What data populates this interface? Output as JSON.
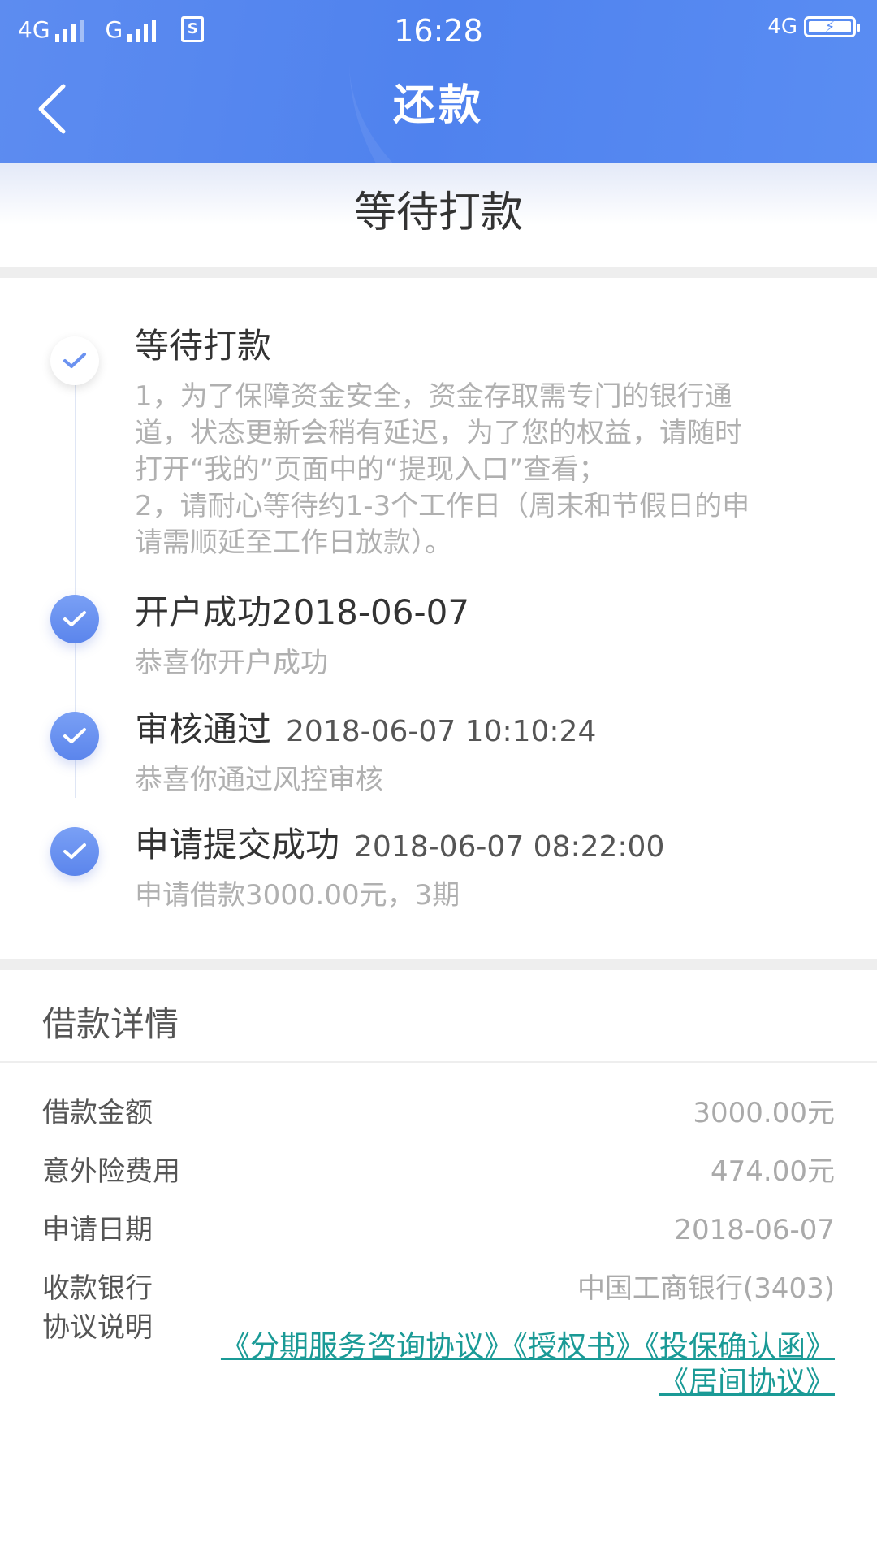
{
  "status_bar": {
    "sim1_label": "4G",
    "sim2_label": "G",
    "sim_icon": "S",
    "time": "16:28",
    "network": "4G",
    "battery_icon": "battery-charging-icon"
  },
  "nav": {
    "back_icon": "chevron-left-icon",
    "title": "还款"
  },
  "status_banner": "等待打款",
  "timeline": [
    {
      "title": "等待打款",
      "time": "",
      "lines": [
        "1，为了保障资金安全，资金存取需专门的银行通",
        "道，状态更新会稍有延迟，为了您的权益，请随时",
        "打开“我的”页面中的“提现入口”查看；",
        "2，请耐心等待约1-3个工作日（周末和节假日的申",
        "请需顺延至工作日放款）。"
      ]
    },
    {
      "title": "开户成功2018-06-07",
      "time": "",
      "desc": "恭喜你开户成功"
    },
    {
      "title": "审核通过",
      "time": "2018-06-07 10:10:24",
      "desc": "恭喜你通过风控审核"
    },
    {
      "title": "申请提交成功",
      "time": "2018-06-07 08:22:00",
      "desc": "申请借款3000.00元，3期"
    }
  ],
  "details": {
    "heading": "借款详情",
    "rows": [
      {
        "label": "借款金额",
        "value": "3000.00元"
      },
      {
        "label": "意外险费用",
        "value": "474.00元"
      },
      {
        "label": "申请日期",
        "value": "2018-06-07"
      },
      {
        "label": "收款银行",
        "value": "中国工商银行(3403)"
      }
    ],
    "agreement_label": "协议说明",
    "agreements": [
      "《分期服务咨询协议》",
      "《授权书》",
      "《投保确认函》",
      "《居间协议》"
    ]
  },
  "colors": {
    "header_blue": "#5a8df3",
    "link_teal": "#1a9a96",
    "check_blue": "#6b92f0"
  }
}
